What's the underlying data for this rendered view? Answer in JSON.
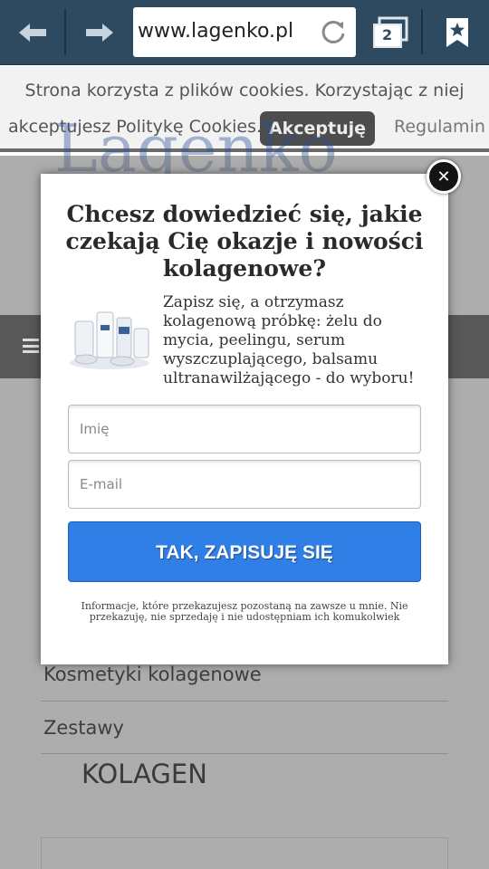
{
  "browser": {
    "url": "www.lagenko.pl",
    "tab_count": "2"
  },
  "cookie_bar": {
    "line1": "Strona korzysta z plików cookies. Korzystając z niej",
    "line2": "akceptujesz Politykę Cookies.",
    "accept_label": "Akceptuję",
    "regulamin_label": "Regulamin"
  },
  "page": {
    "logo": "Lagenko",
    "menu_items": [
      "Kosmetyki kolagenowe",
      "Zestawy"
    ],
    "section_title": "KOLAGEN"
  },
  "popup": {
    "title": "Chcesz dowiedzieć się, jakie czekają Cię okazje i nowości kolagenowe?",
    "description": "Zapisz się, a otrzymasz kolagenową próbkę: żelu do mycia, peelingu, serum wyszczuplającego, balsamu ultranawilżającego - do wyboru!",
    "name_placeholder": "Imię",
    "email_placeholder": "E-mail",
    "submit_label": "TAK, ZAPISUJĘ SIĘ",
    "disclaimer": "Informacje, które przekazujesz pozostaną na zawsze u mnie. Nie przekazuję, nie sprzedaję i nie udostępniam ich komukolwiek",
    "close_label": "✕"
  },
  "colors": {
    "toolbar": "#2e4a60",
    "submit": "#2f7fe6",
    "logo": "#2b4f9a"
  }
}
